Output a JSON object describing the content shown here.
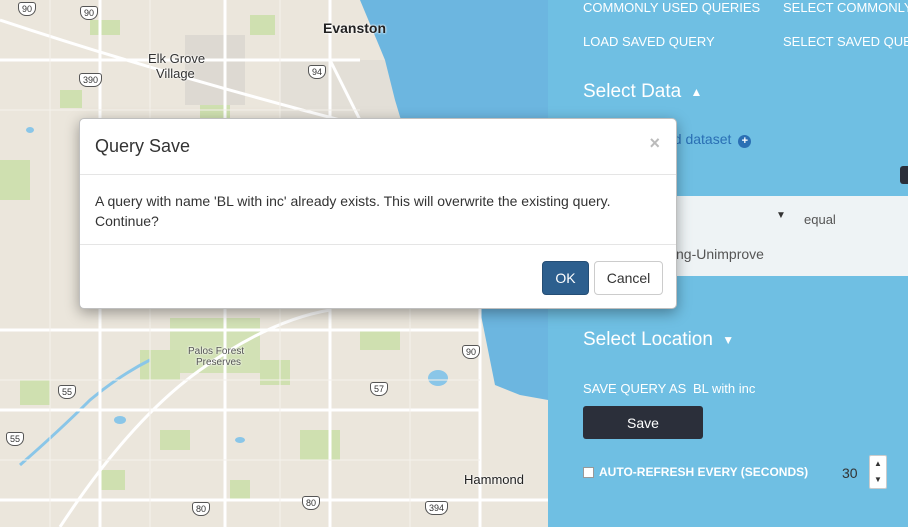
{
  "map": {
    "labels": {
      "evanston": "Evanston",
      "elk_grove_1": "Elk Grove",
      "elk_grove_2": "Village",
      "palos_1": "Palos Forest",
      "palos_2": "Preserves",
      "hammond": "Hammond"
    },
    "shields": {
      "s90a": "90",
      "s90b": "90",
      "s390": "390",
      "s94": "94",
      "s90c": "90",
      "s55a": "55",
      "s57": "57",
      "s55b": "55",
      "s80a": "80",
      "s80b": "80",
      "s394": "394"
    }
  },
  "panel": {
    "common_queries_label": "COMMONLY USED QUERIES",
    "common_queries_value": "SELECT COMMONLY",
    "load_saved_label": "LOAD SAVED QUERY",
    "load_saved_value": "SELECT SAVED QUE",
    "select_data_title": "Select Data",
    "add_dataset": "dd dataset",
    "filter_operator": "equal",
    "filter_value": "ng-Unimprove",
    "select_location_title": "Select Location",
    "save_query_label": "SAVE QUERY AS",
    "save_query_value": "BL with inc",
    "save_button": "Save",
    "auto_refresh_label": "AUTO-REFRESH EVERY (SECONDS)",
    "auto_refresh_value": "30"
  },
  "modal": {
    "title": "Query Save",
    "close": "×",
    "message": "A query with name 'BL with inc' already exists. This will overwrite the existing query. Continue?",
    "ok": "OK",
    "cancel": "Cancel"
  },
  "colors": {
    "panel_bg": "#6fbfe3",
    "water": "#6cb6e0",
    "primary_button": "#2d5f8e",
    "dark_button": "#2b2f3a"
  }
}
